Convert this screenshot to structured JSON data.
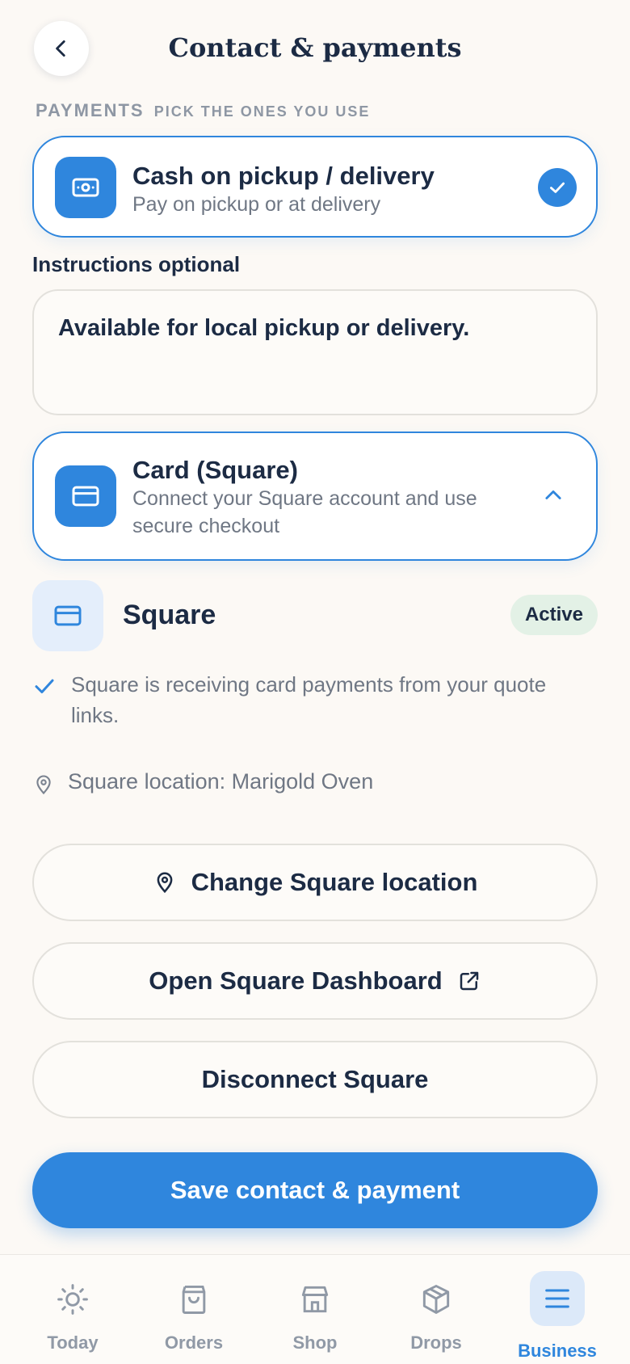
{
  "header": {
    "title": "Contact & payments"
  },
  "payments": {
    "label": "PAYMENTS",
    "sublabel": "PICK THE ONES YOU USE"
  },
  "cash": {
    "title": "Cash on pickup / delivery",
    "subtitle": "Pay on pickup or at delivery",
    "selected": true
  },
  "instructions": {
    "label": "Instructions optional",
    "value": "Available for local pickup or delivery."
  },
  "card": {
    "title": "Card (Square)",
    "subtitle_line1": "Connect your Square account and use",
    "subtitle_line2": "secure checkout",
    "expanded": true
  },
  "square": {
    "name": "Square",
    "badge": "Active",
    "status": "Square is receiving card payments from your quote links.",
    "location": "Square location: Marigold Oven",
    "change_location_label": "Change Square location",
    "dashboard_label": "Open Square Dashboard",
    "disconnect_label": "Disconnect Square"
  },
  "save_label": "Save contact & payment",
  "tabs": [
    {
      "label": "Today",
      "icon": "sun-icon"
    },
    {
      "label": "Orders",
      "icon": "bag-icon"
    },
    {
      "label": "Shop",
      "icon": "store-icon"
    },
    {
      "label": "Drops",
      "icon": "box-icon"
    },
    {
      "label": "Business",
      "icon": "menu-icon",
      "active": true
    }
  ],
  "colors": {
    "accent": "#2f86dd",
    "text": "#1c2b44",
    "muted": "#6f7784",
    "background": "#fcf9f5",
    "badge_bg": "#e3f1e6"
  }
}
